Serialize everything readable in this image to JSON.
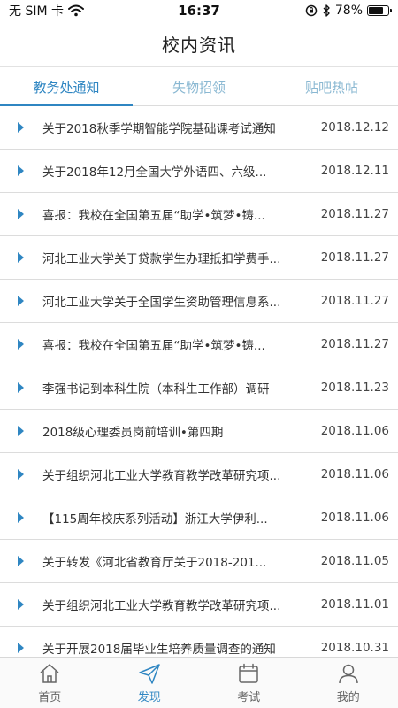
{
  "status_bar": {
    "carrier": "无 SIM 卡",
    "time": "16:37",
    "battery": "78%",
    "battery_level": 0.78,
    "icons": [
      "wifi-icon",
      "rotation-lock-icon",
      "bluetooth-icon",
      "battery-icon"
    ]
  },
  "header": {
    "title": "校内资讯"
  },
  "tabs": [
    {
      "label": "教务处通知",
      "active": true
    },
    {
      "label": "失物招领",
      "active": false
    },
    {
      "label": "贴吧热帖",
      "active": false
    }
  ],
  "news": [
    {
      "title": "关于2018秋季学期智能学院基础课考试通知",
      "date": "2018.12.12"
    },
    {
      "title": "关于2018年12月全国大学外语四、六级...",
      "date": "2018.12.11"
    },
    {
      "title": "喜报：我校在全国第五届“助学•筑梦•铸...",
      "date": "2018.11.27"
    },
    {
      "title": "河北工业大学关于贷款学生办理抵扣学费手...",
      "date": "2018.11.27"
    },
    {
      "title": "河北工业大学关于全国学生资助管理信息系...",
      "date": "2018.11.27"
    },
    {
      "title": "喜报：我校在全国第五届“助学•筑梦•铸...",
      "date": "2018.11.27"
    },
    {
      "title": "李强书记到本科生院（本科生工作部）调研",
      "date": "2018.11.23"
    },
    {
      "title": "2018级心理委员岗前培训•第四期",
      "date": "2018.11.06"
    },
    {
      "title": "关于组织河北工业大学教育教学改革研究项...",
      "date": "2018.11.06"
    },
    {
      "title": "【115周年校庆系列活动】浙江大学伊利...",
      "date": "2018.11.06"
    },
    {
      "title": "关于转发《河北省教育厅关于2018-201...",
      "date": "2018.11.05"
    },
    {
      "title": "关于组织河北工业大学教育教学改革研究项...",
      "date": "2018.11.01"
    },
    {
      "title": "关于开展2018届毕业生培养质量调查的通知",
      "date": "2018.10.31"
    }
  ],
  "tab_bar": [
    {
      "label": "首页",
      "icon": "home-icon",
      "active": false
    },
    {
      "label": "发现",
      "icon": "send-icon",
      "active": true
    },
    {
      "label": "考试",
      "icon": "calendar-icon",
      "active": false
    },
    {
      "label": "我的",
      "icon": "user-icon",
      "active": false
    }
  ],
  "colors": {
    "accent": "#2f86c2",
    "tab_inactive": "#8ab8d2",
    "divider": "#dcdcdc"
  }
}
